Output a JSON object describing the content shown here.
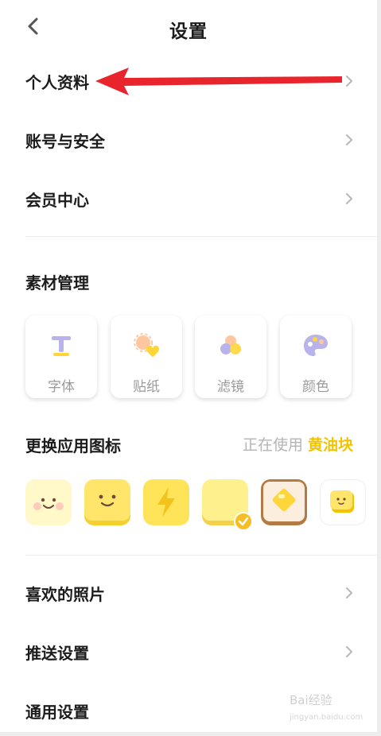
{
  "header": {
    "title": "设置"
  },
  "account_rows": [
    {
      "label": "个人资料"
    },
    {
      "label": "账号与安全"
    },
    {
      "label": "会员中心"
    }
  ],
  "materials": {
    "title": "素材管理",
    "items": [
      {
        "label": "字体",
        "icon": "font-icon"
      },
      {
        "label": "贴纸",
        "icon": "sticker-icon"
      },
      {
        "label": "滤镜",
        "icon": "filter-icon"
      },
      {
        "label": "颜色",
        "icon": "palette-icon"
      }
    ]
  },
  "app_icon": {
    "title": "更换应用图标",
    "using_prefix": "正在使用",
    "using_name": "黄油块",
    "selected_index": 3,
    "options": [
      "smile-face-icon",
      "yellow-smile-icon",
      "lightning-icon",
      "butter-block-icon",
      "toast-icon",
      "mini-block-icon"
    ]
  },
  "other_rows": [
    {
      "label": "喜欢的照片"
    },
    {
      "label": "推送设置"
    },
    {
      "label": "通用设置"
    }
  ],
  "watermark": {
    "text": "Bai经验",
    "sub": "jingyan.baidu.com"
  },
  "colors": {
    "accent": "#f3c300",
    "arrow_annotation": "#e8242c",
    "secondary_text": "#9a9a9a"
  }
}
